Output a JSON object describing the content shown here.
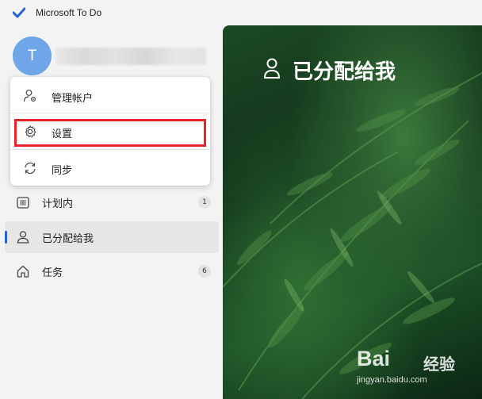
{
  "app": {
    "title": "Microsoft To Do"
  },
  "account": {
    "avatar_initial": "T"
  },
  "account_menu": {
    "items": [
      {
        "label": "管理帐户",
        "icon": "person-gear-icon"
      },
      {
        "label": "设置",
        "icon": "gear-icon",
        "highlighted": true
      },
      {
        "label": "同步",
        "icon": "sync-icon"
      }
    ],
    "highlight_color": "#e8242b"
  },
  "sidebar": {
    "items": [
      {
        "label": "计划内",
        "icon": "calendar-icon",
        "count": "1"
      },
      {
        "label": "已分配给我",
        "icon": "person-icon",
        "selected": true
      },
      {
        "label": "任务",
        "icon": "home-icon",
        "count": "6"
      }
    ],
    "accent": "#2564cf"
  },
  "main": {
    "list_title": "已分配给我"
  },
  "watermark": {
    "logo": "Bai",
    "cn": "经验",
    "url": "jingyan.baidu.com"
  }
}
